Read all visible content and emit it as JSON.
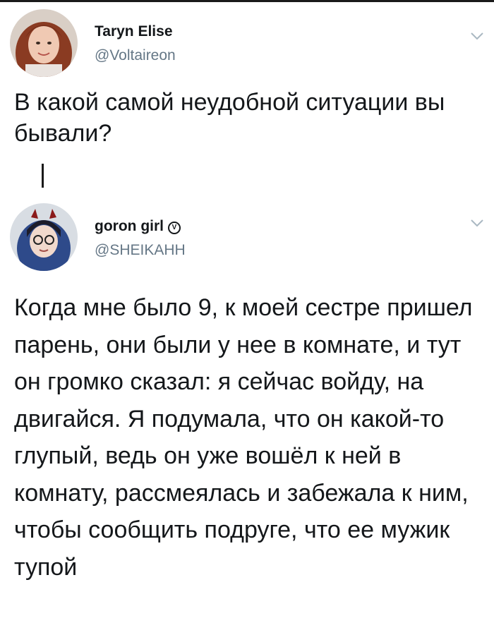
{
  "tweets": [
    {
      "author_name": "Taryn Elise",
      "author_handle": "@Voltaireon",
      "text": "В какой самой неудобной ситуации вы бывали?"
    },
    {
      "author_name": "goron girl",
      "verified_badge": "V",
      "author_handle": "@SHEIKAHH",
      "text": "Когда мне было 9, к моей сестре пришел парень, они были у нее в комнате, и тут он громко сказал: я сейчас войду, на двигайся. Я подумала, что он какой-то глупый, ведь он уже вошёл к ней в комнату, рассмеялась и забежала к ним, чтобы сообщить подруге, что ее мужик тупой"
    }
  ],
  "icons": {
    "menu": "chevron-down-icon"
  },
  "colors": {
    "name": "#14171a",
    "handle": "#657786",
    "background": "#ffffff"
  }
}
